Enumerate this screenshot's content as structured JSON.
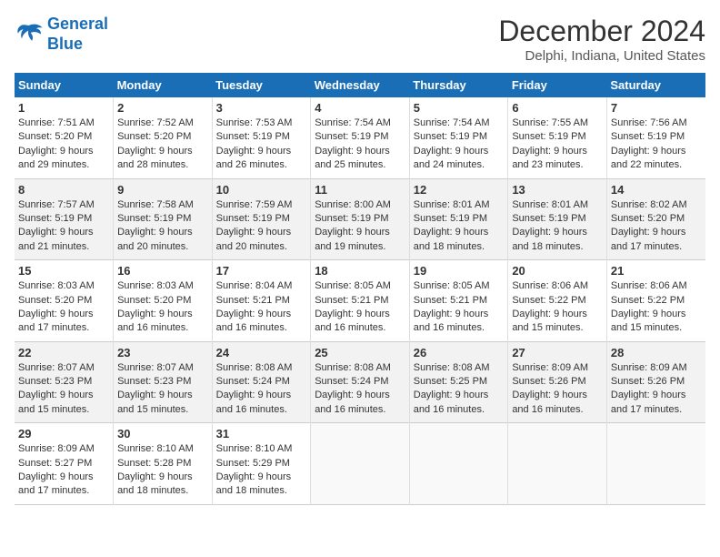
{
  "logo": {
    "line1": "General",
    "line2": "Blue"
  },
  "title": "December 2024",
  "subtitle": "Delphi, Indiana, United States",
  "days_header": [
    "Sunday",
    "Monday",
    "Tuesday",
    "Wednesday",
    "Thursday",
    "Friday",
    "Saturday"
  ],
  "weeks": [
    [
      {
        "num": "1",
        "sunrise": "Sunrise: 7:51 AM",
        "sunset": "Sunset: 5:20 PM",
        "daylight": "Daylight: 9 hours and 29 minutes."
      },
      {
        "num": "2",
        "sunrise": "Sunrise: 7:52 AM",
        "sunset": "Sunset: 5:20 PM",
        "daylight": "Daylight: 9 hours and 28 minutes."
      },
      {
        "num": "3",
        "sunrise": "Sunrise: 7:53 AM",
        "sunset": "Sunset: 5:19 PM",
        "daylight": "Daylight: 9 hours and 26 minutes."
      },
      {
        "num": "4",
        "sunrise": "Sunrise: 7:54 AM",
        "sunset": "Sunset: 5:19 PM",
        "daylight": "Daylight: 9 hours and 25 minutes."
      },
      {
        "num": "5",
        "sunrise": "Sunrise: 7:54 AM",
        "sunset": "Sunset: 5:19 PM",
        "daylight": "Daylight: 9 hours and 24 minutes."
      },
      {
        "num": "6",
        "sunrise": "Sunrise: 7:55 AM",
        "sunset": "Sunset: 5:19 PM",
        "daylight": "Daylight: 9 hours and 23 minutes."
      },
      {
        "num": "7",
        "sunrise": "Sunrise: 7:56 AM",
        "sunset": "Sunset: 5:19 PM",
        "daylight": "Daylight: 9 hours and 22 minutes."
      }
    ],
    [
      {
        "num": "8",
        "sunrise": "Sunrise: 7:57 AM",
        "sunset": "Sunset: 5:19 PM",
        "daylight": "Daylight: 9 hours and 21 minutes."
      },
      {
        "num": "9",
        "sunrise": "Sunrise: 7:58 AM",
        "sunset": "Sunset: 5:19 PM",
        "daylight": "Daylight: 9 hours and 20 minutes."
      },
      {
        "num": "10",
        "sunrise": "Sunrise: 7:59 AM",
        "sunset": "Sunset: 5:19 PM",
        "daylight": "Daylight: 9 hours and 20 minutes."
      },
      {
        "num": "11",
        "sunrise": "Sunrise: 8:00 AM",
        "sunset": "Sunset: 5:19 PM",
        "daylight": "Daylight: 9 hours and 19 minutes."
      },
      {
        "num": "12",
        "sunrise": "Sunrise: 8:01 AM",
        "sunset": "Sunset: 5:19 PM",
        "daylight": "Daylight: 9 hours and 18 minutes."
      },
      {
        "num": "13",
        "sunrise": "Sunrise: 8:01 AM",
        "sunset": "Sunset: 5:19 PM",
        "daylight": "Daylight: 9 hours and 18 minutes."
      },
      {
        "num": "14",
        "sunrise": "Sunrise: 8:02 AM",
        "sunset": "Sunset: 5:20 PM",
        "daylight": "Daylight: 9 hours and 17 minutes."
      }
    ],
    [
      {
        "num": "15",
        "sunrise": "Sunrise: 8:03 AM",
        "sunset": "Sunset: 5:20 PM",
        "daylight": "Daylight: 9 hours and 17 minutes."
      },
      {
        "num": "16",
        "sunrise": "Sunrise: 8:03 AM",
        "sunset": "Sunset: 5:20 PM",
        "daylight": "Daylight: 9 hours and 16 minutes."
      },
      {
        "num": "17",
        "sunrise": "Sunrise: 8:04 AM",
        "sunset": "Sunset: 5:21 PM",
        "daylight": "Daylight: 9 hours and 16 minutes."
      },
      {
        "num": "18",
        "sunrise": "Sunrise: 8:05 AM",
        "sunset": "Sunset: 5:21 PM",
        "daylight": "Daylight: 9 hours and 16 minutes."
      },
      {
        "num": "19",
        "sunrise": "Sunrise: 8:05 AM",
        "sunset": "Sunset: 5:21 PM",
        "daylight": "Daylight: 9 hours and 16 minutes."
      },
      {
        "num": "20",
        "sunrise": "Sunrise: 8:06 AM",
        "sunset": "Sunset: 5:22 PM",
        "daylight": "Daylight: 9 hours and 15 minutes."
      },
      {
        "num": "21",
        "sunrise": "Sunrise: 8:06 AM",
        "sunset": "Sunset: 5:22 PM",
        "daylight": "Daylight: 9 hours and 15 minutes."
      }
    ],
    [
      {
        "num": "22",
        "sunrise": "Sunrise: 8:07 AM",
        "sunset": "Sunset: 5:23 PM",
        "daylight": "Daylight: 9 hours and 15 minutes."
      },
      {
        "num": "23",
        "sunrise": "Sunrise: 8:07 AM",
        "sunset": "Sunset: 5:23 PM",
        "daylight": "Daylight: 9 hours and 15 minutes."
      },
      {
        "num": "24",
        "sunrise": "Sunrise: 8:08 AM",
        "sunset": "Sunset: 5:24 PM",
        "daylight": "Daylight: 9 hours and 16 minutes."
      },
      {
        "num": "25",
        "sunrise": "Sunrise: 8:08 AM",
        "sunset": "Sunset: 5:24 PM",
        "daylight": "Daylight: 9 hours and 16 minutes."
      },
      {
        "num": "26",
        "sunrise": "Sunrise: 8:08 AM",
        "sunset": "Sunset: 5:25 PM",
        "daylight": "Daylight: 9 hours and 16 minutes."
      },
      {
        "num": "27",
        "sunrise": "Sunrise: 8:09 AM",
        "sunset": "Sunset: 5:26 PM",
        "daylight": "Daylight: 9 hours and 16 minutes."
      },
      {
        "num": "28",
        "sunrise": "Sunrise: 8:09 AM",
        "sunset": "Sunset: 5:26 PM",
        "daylight": "Daylight: 9 hours and 17 minutes."
      }
    ],
    [
      {
        "num": "29",
        "sunrise": "Sunrise: 8:09 AM",
        "sunset": "Sunset: 5:27 PM",
        "daylight": "Daylight: 9 hours and 17 minutes."
      },
      {
        "num": "30",
        "sunrise": "Sunrise: 8:10 AM",
        "sunset": "Sunset: 5:28 PM",
        "daylight": "Daylight: 9 hours and 18 minutes."
      },
      {
        "num": "31",
        "sunrise": "Sunrise: 8:10 AM",
        "sunset": "Sunset: 5:29 PM",
        "daylight": "Daylight: 9 hours and 18 minutes."
      },
      null,
      null,
      null,
      null
    ]
  ]
}
